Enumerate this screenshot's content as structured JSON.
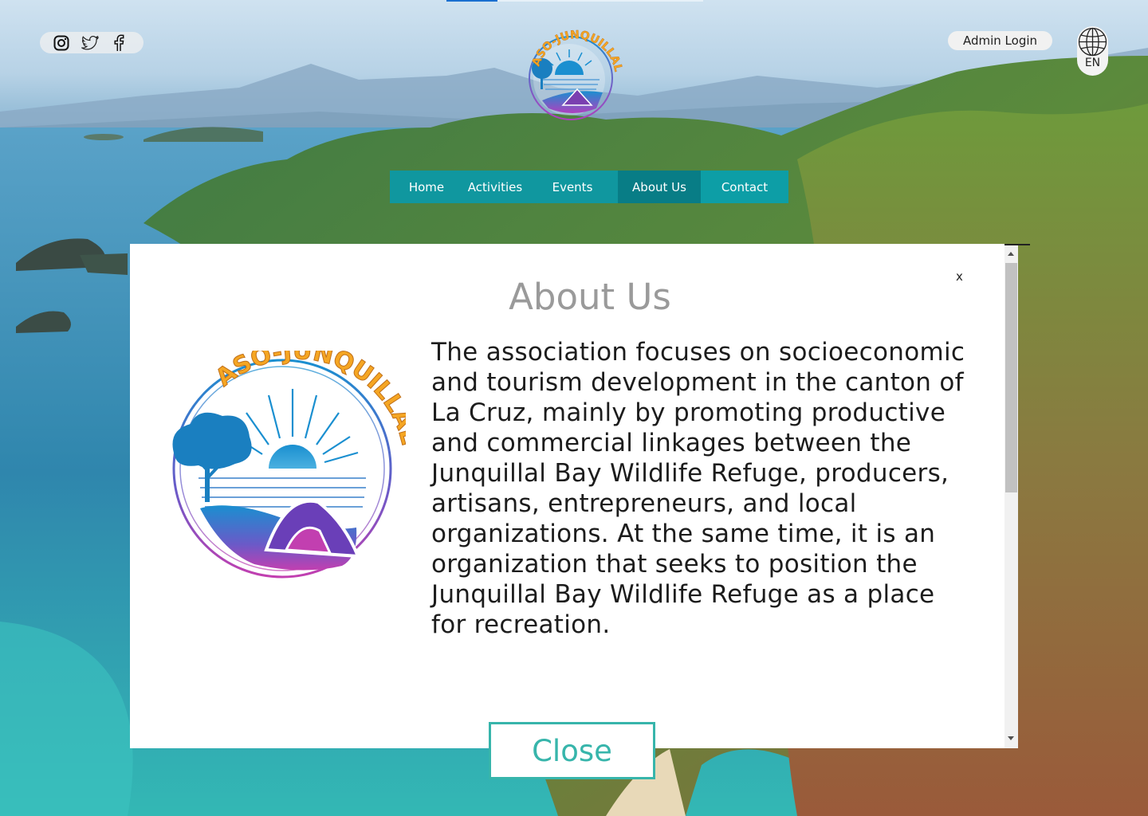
{
  "social": {
    "icons": [
      "instagram-icon",
      "twitter-icon",
      "facebook-icon"
    ]
  },
  "header": {
    "admin_login": "Admin Login",
    "language_code": "EN",
    "logo_text": "ASO-JUNQUILLAL"
  },
  "nav": {
    "items": [
      {
        "label": "Home"
      },
      {
        "label": "Activities"
      },
      {
        "label": "Events"
      },
      {
        "label": "About Us",
        "active": true
      },
      {
        "label": "Contact"
      }
    ]
  },
  "modal": {
    "title": "About Us",
    "close_x": "x",
    "body": "The association focuses on socioeconomic and tourism development in the canton of La Cruz, mainly by promoting productive and commercial linkages between the Junquillal Bay Wildlife Refuge, producers, artisans, entrepreneurs, and local organizations. At the same time, it is an organization that seeks to position the Junquillal Bay Wildlife Refuge as a place for recreation.",
    "close_button": "Close"
  },
  "colors": {
    "nav_bg": "#10979f",
    "nav_active": "#087d86",
    "accent_teal": "#37b5ab",
    "logo_orange": "#f5a623",
    "logo_blue": "#1a8fd0",
    "logo_purple": "#9b3fbf"
  }
}
